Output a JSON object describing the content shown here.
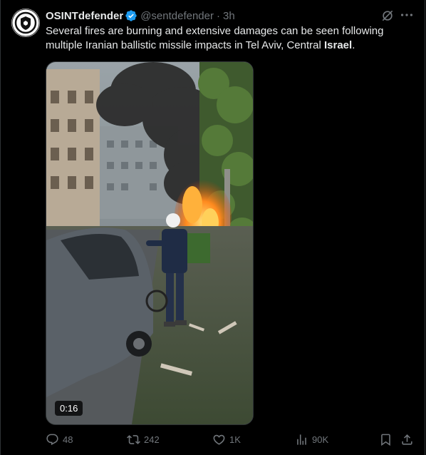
{
  "tweet": {
    "display_name": "OSINTdefender",
    "handle": "@sentdefender",
    "separator": "·",
    "time": "3h",
    "text_before": "Several fires are burning and extensive damages can be seen following multiple Iranian ballistic missile impacts in Tel Aviv, Central ",
    "text_bold": "Israel",
    "text_after": "."
  },
  "media": {
    "duration": "0:16"
  },
  "actions": {
    "replies": "48",
    "reposts": "242",
    "likes": "1K",
    "views": "90K"
  },
  "icons": {
    "verified": "verified-badge-icon",
    "grok": "grok-icon",
    "more": "more-icon",
    "reply": "reply-icon",
    "repost": "repost-icon",
    "like": "like-icon",
    "views": "views-icon",
    "bookmark": "bookmark-icon",
    "share": "share-icon"
  },
  "colors": {
    "accent": "#1d9bf0",
    "text": "#e7e9ea",
    "muted": "#71767b",
    "background": "#000000"
  }
}
